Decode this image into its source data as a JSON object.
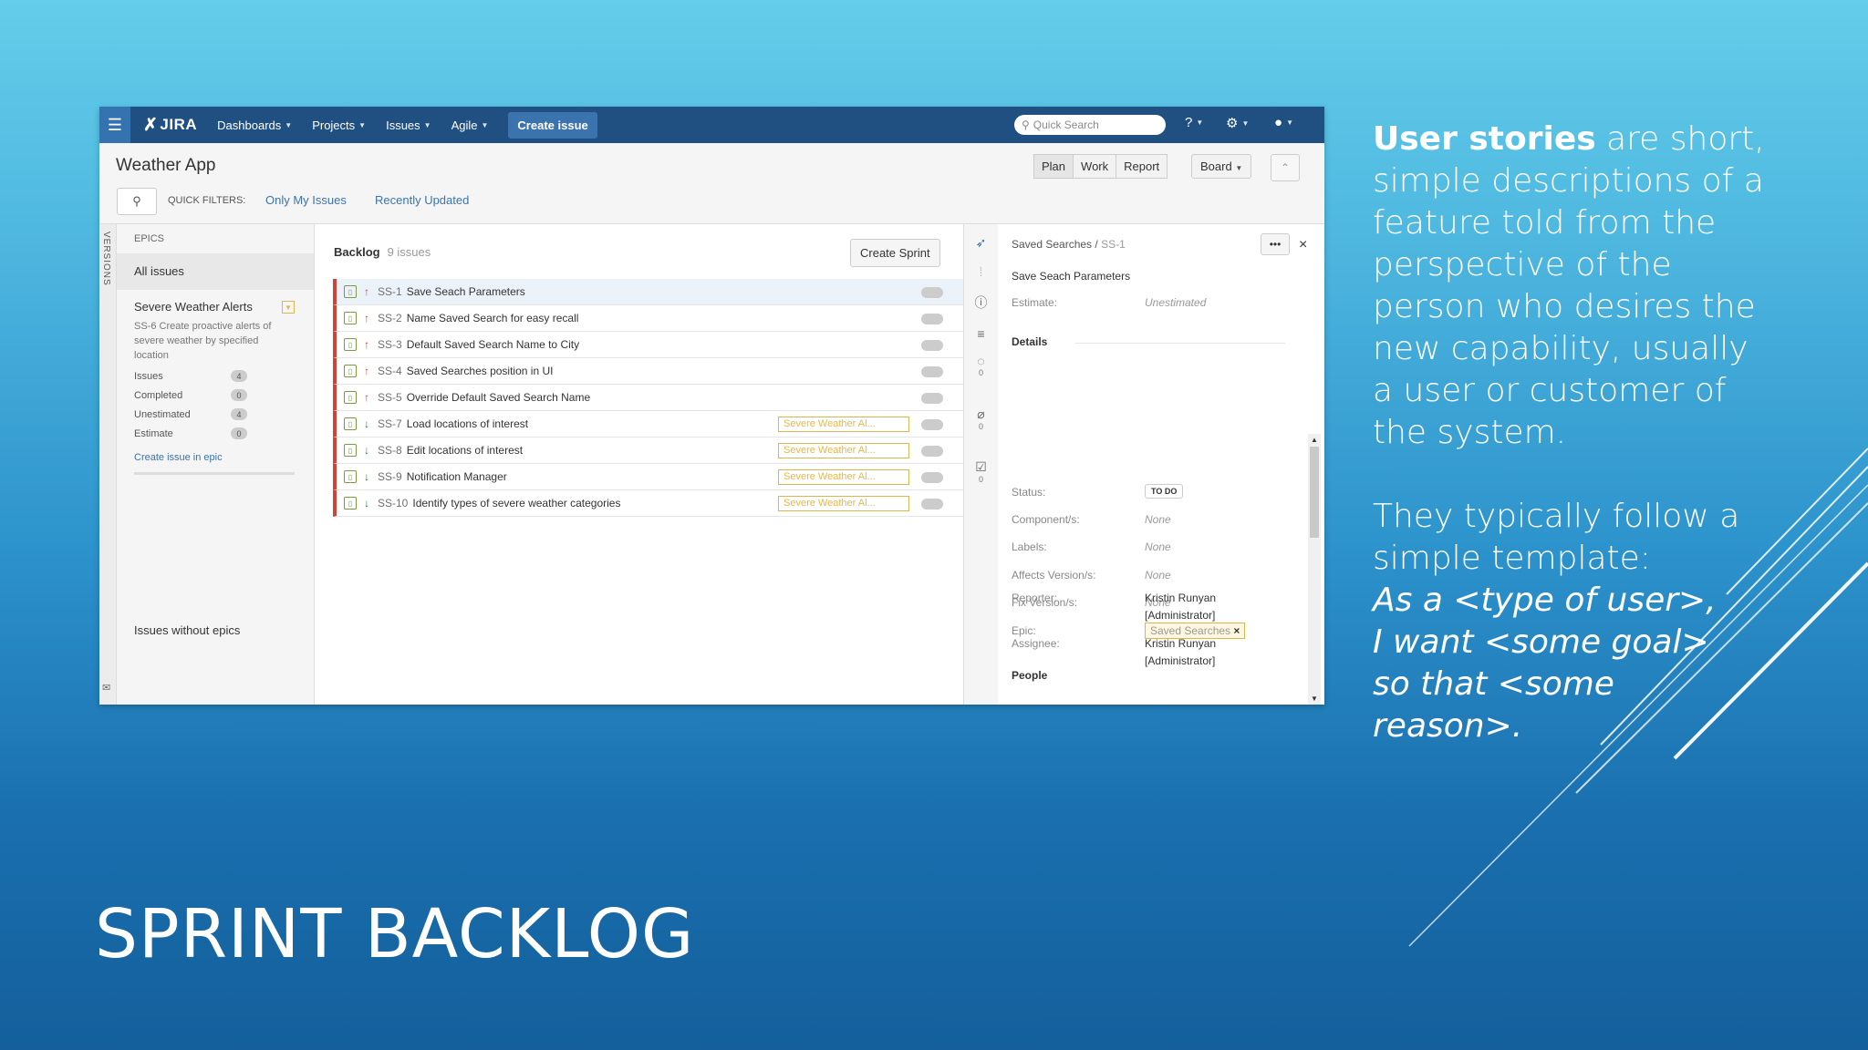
{
  "slide": {
    "title": "SPRINT BACKLOG",
    "body_bold": "User stories",
    "body_rest": " are short, simple descriptions of a feature told from the perspective of the person who desires the new capability, usually a user or customer of the system.",
    "template_intro": "They typically follow a simple template:",
    "template_lines": [
      "As a <type of user>,",
      "I want <some goal>",
      "so that <some reason>."
    ]
  },
  "jira": {
    "logo": "JIRA",
    "nav": [
      "Dashboards",
      "Projects",
      "Issues",
      "Agile"
    ],
    "create_issue": "Create issue",
    "quick_search_placeholder": "Quick Search",
    "project_title": "Weather App",
    "quick_filters_label": "QUICK FILTERS:",
    "quick_filters": [
      "Only My Issues",
      "Recently Updated"
    ],
    "modes": [
      "Plan",
      "Work",
      "Report"
    ],
    "board": "Board",
    "versions_label": "VERSIONS",
    "epics": {
      "header": "EPICS",
      "all_issues": "All issues",
      "epic_name": "Severe Weather Alerts",
      "epic_desc": "SS-6 Create proactive alerts of severe weather by specified location",
      "stats": [
        {
          "label": "Issues",
          "value": "4"
        },
        {
          "label": "Completed",
          "value": "0"
        },
        {
          "label": "Unestimated",
          "value": "4"
        },
        {
          "label": "Estimate",
          "value": "0"
        }
      ],
      "create_in_epic": "Create issue in epic",
      "without_epics": "Issues without epics"
    },
    "backlog": {
      "title": "Backlog",
      "count": "9 issues",
      "create_sprint": "Create Sprint",
      "issues": [
        {
          "key": "SS-1",
          "summary": "Save Seach Parameters",
          "priority": "up",
          "epic": ""
        },
        {
          "key": "SS-2",
          "summary": "Name Saved Search for easy recall",
          "priority": "up",
          "epic": ""
        },
        {
          "key": "SS-3",
          "summary": "Default Saved Search Name to City",
          "priority": "up",
          "epic": ""
        },
        {
          "key": "SS-4",
          "summary": "Saved Searches position in UI",
          "priority": "up",
          "epic": ""
        },
        {
          "key": "SS-5",
          "summary": "Override Default Saved Search Name",
          "priority": "up",
          "epic": ""
        },
        {
          "key": "SS-7",
          "summary": "Load locations of interest",
          "priority": "down",
          "epic": "Severe Weather Al..."
        },
        {
          "key": "SS-8",
          "summary": "Edit locations of interest",
          "priority": "down",
          "epic": "Severe Weather Al..."
        },
        {
          "key": "SS-9",
          "summary": "Notification Manager",
          "priority": "down",
          "epic": "Severe Weather Al..."
        },
        {
          "key": "SS-10",
          "summary": "Identify types of severe weather categories",
          "priority": "down",
          "epic": "Severe Weather Al..."
        }
      ]
    },
    "rail_counts": [
      "0",
      "0",
      "0"
    ],
    "detail": {
      "breadcrumb_parent": "Saved Searches /",
      "breadcrumb_key": "SS-1",
      "more": "•••",
      "close": "×",
      "title": "Save Seach Parameters",
      "estimate_label": "Estimate:",
      "estimate_value": "Unestimated",
      "details_header": "Details",
      "status_label": "Status:",
      "status_value": "TO DO",
      "components_label": "Component/s:",
      "components_value": "None",
      "labels_label": "Labels:",
      "labels_value": "None",
      "affects_label": "Affects Version/s:",
      "affects_value": "None",
      "fix_label": "Fix Version/s:",
      "fix_value": "None",
      "epic_label": "Epic:",
      "epic_value": "Saved Searches",
      "people_header": "People",
      "reporter_label": "Reporter:",
      "reporter_name": "Kristin Runyan",
      "reporter_role": "[Administrator]",
      "assignee_label": "Assignee:",
      "assignee_name": "Kristin Runyan",
      "assignee_role": "[Administrator]"
    }
  },
  "colors": {
    "jira_header": "#205081",
    "create_issue": "#3b73af",
    "high_priority": "#d04437",
    "low_priority": "#14892c",
    "epic_gold": "#d9b64e"
  }
}
